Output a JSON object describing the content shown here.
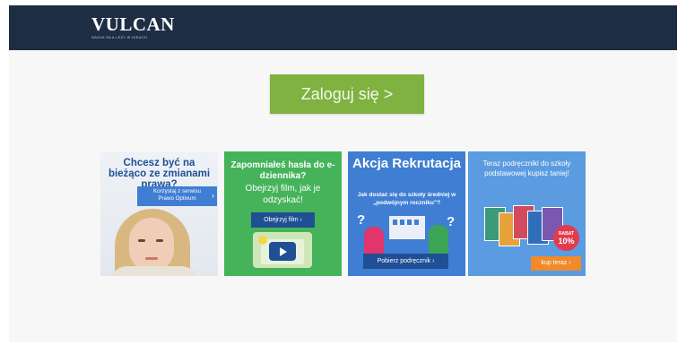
{
  "header": {
    "logo_text": "VULCAN",
    "logo_tagline": "NASZA SIŁA LEŻY W IDEACH"
  },
  "login": {
    "label": "Zaloguj się >"
  },
  "banners": [
    {
      "title": "Chcesz być na bieżąco ze zmianami prawa?",
      "cta_line1": "Korzystaj z serwisu",
      "cta_line2": "Prawo Optivum",
      "cta_arrow": "›"
    },
    {
      "title": "Zapomniałeś hasła do e-dziennika?",
      "subtitle": "Obejrzyj film, jak je odzyskać!",
      "cta": "Obejrzyj film ›"
    },
    {
      "title": "Akcja Rekrutacja",
      "subtitle": "Jak dostać się do szkoły średniej w „podwójnym roczniku”?",
      "q": "?",
      "cta": "Pobierz podręcznik ›"
    },
    {
      "title": "Teraz podręczniki do szkoły podstawowej kupisz taniej!",
      "badge_label": "RABAT",
      "badge_value": "10%",
      "cta": "kup teraz ›"
    }
  ],
  "colors": {
    "header": "#1d2d44",
    "login": "#7fb240",
    "green": "#45b35a",
    "blue": "#3f7ed3",
    "orange": "#f08a2b"
  }
}
